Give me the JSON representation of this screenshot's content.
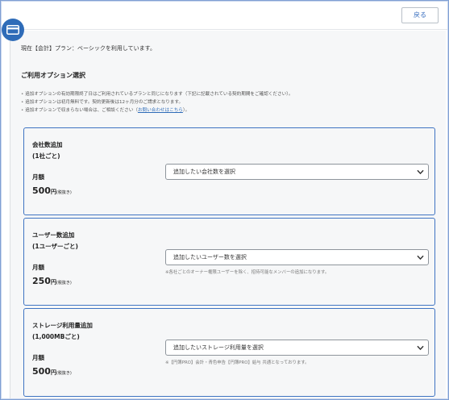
{
  "header": {
    "back_label": "戻る"
  },
  "icons": {
    "plan_icon": "credit-card-icon"
  },
  "intro": {
    "text": "現在【会計】プラン：ベーシックを利用しています。"
  },
  "section": {
    "title": "ご利用オプション選択"
  },
  "notes": {
    "n1": "追加オプションの有効期限終了日はご利用されているプランと同じになります（下記に記載されている契約期間をご確認ください）。",
    "n2": "追加オプションは初月無料です。契約更新後は12ヶ月分のご請求となります。",
    "n3_pre": "追加オプションで収まらない場合は、ご相談ください（",
    "n3_link": "お問い合わせはこちら",
    "n3_post": "）。"
  },
  "options": [
    {
      "name_line1": "会社数追加",
      "name_line2": "(1社ごと)",
      "monthly_label": "月額",
      "price": "500",
      "price_unit": "円",
      "tax_label": "(税抜き)",
      "select_value": "追加したい会社数を選択",
      "note": ""
    },
    {
      "name_line1": "ユーザー数追加",
      "name_line2": "(1ユーザーごと)",
      "monthly_label": "月額",
      "price": "250",
      "price_unit": "円",
      "tax_label": "(税抜き)",
      "select_value": "追加したいユーザー数を選択",
      "note": "※各社ごとのオーナー権限ユーザーを除く、招待可能なメンバーの追加になります。"
    },
    {
      "name_line1": "ストレージ利用量追加",
      "name_line2": "(1,000MBごと)",
      "monthly_label": "月額",
      "price": "500",
      "price_unit": "円",
      "tax_label": "(税抜き)",
      "select_value": "追加したいストレージ利用量を選択",
      "note": "※【円簿PRO】会計・青色申告【円簿PRO】給与 共通となっております。"
    }
  ],
  "colors": {
    "accent": "#2f6cb8",
    "option_border": "#3f74c2",
    "background": "#f6f7f8"
  }
}
